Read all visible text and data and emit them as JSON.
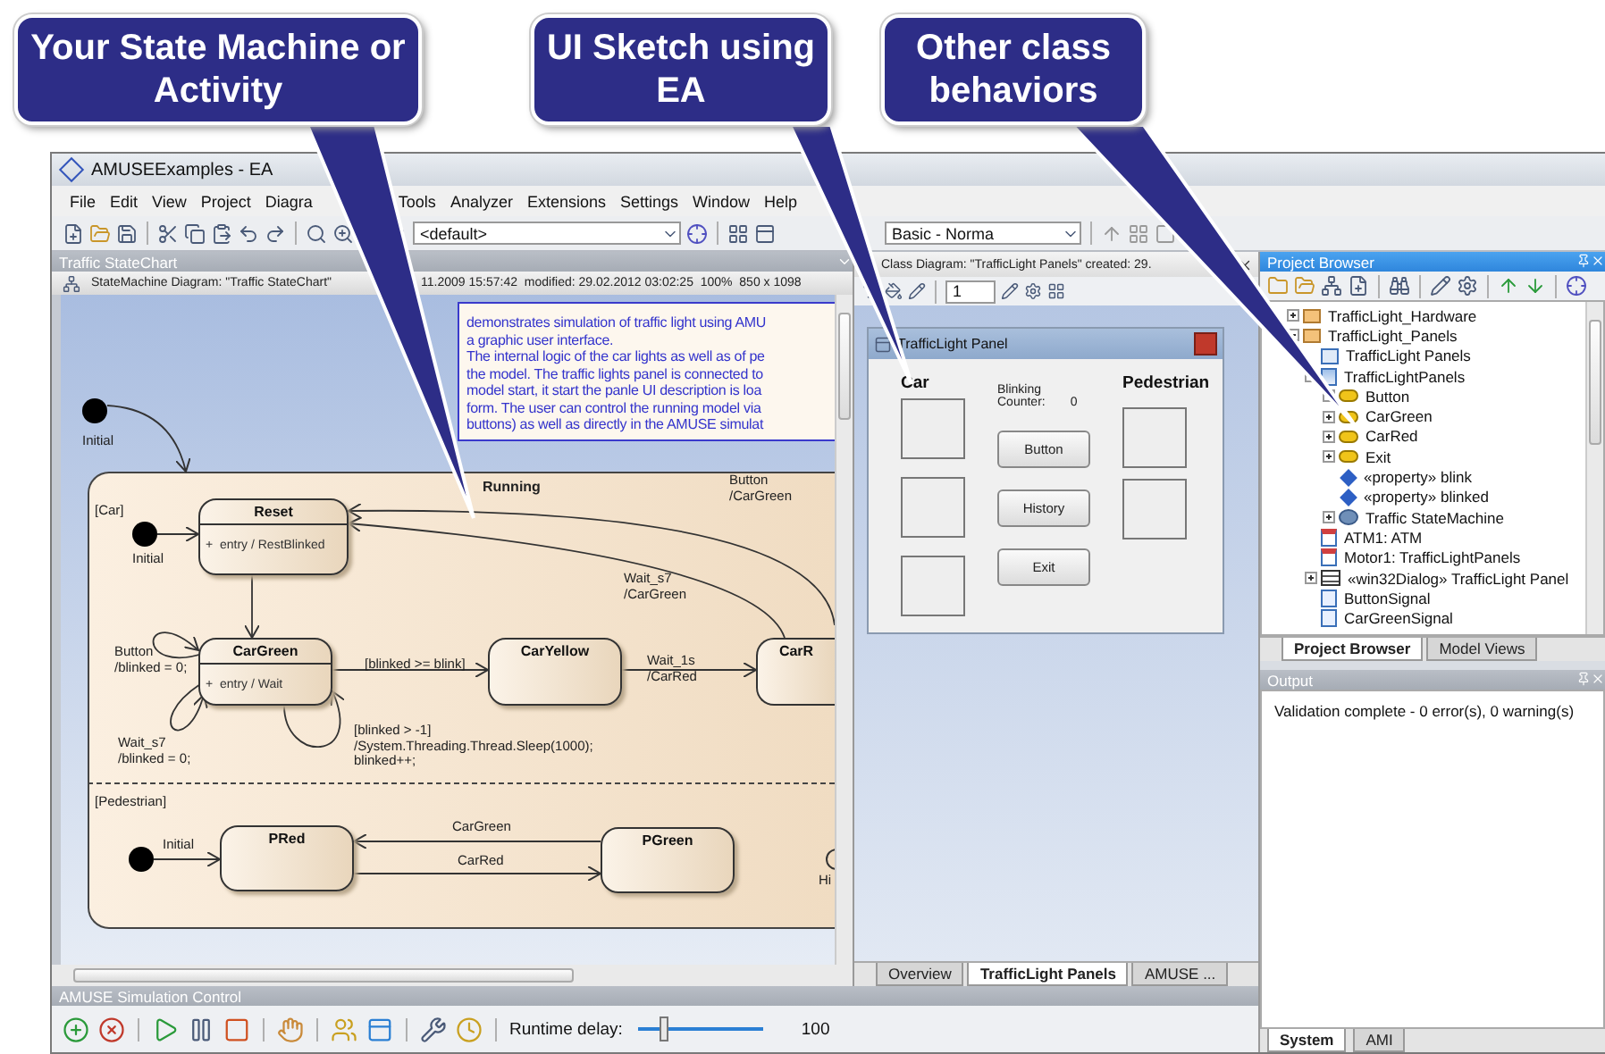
{
  "callouts": [
    {
      "text": "Your State Machine or Activity"
    },
    {
      "text": "UI Sketch using EA"
    },
    {
      "text": "Other class behaviors"
    }
  ],
  "window": {
    "title": "AMUSEExamples - EA"
  },
  "menu": [
    "File",
    "Edit",
    "View",
    "Project",
    "Diagra",
    "Tools",
    "Analyzer",
    "Extensions",
    "Settings",
    "Window",
    "Help"
  ],
  "toolbar": {
    "perspective": "<default>",
    "workspace": "Basic - Norma"
  },
  "state_chart": {
    "tab_title": "Traffic StateChart",
    "diagram_info": "StateMachine Diagram: \"Traffic StateChart\"",
    "diagram_meta": "11.2009 15:57:42  modified: 29.02.2012 03:02:25  100%  850 x 1098",
    "note": [
      "demonstrates simulation of traffic light using AMU",
      "a graphic user interface.",
      "The internal logic of the car lights as well as of pe",
      "the model. The traffic lights panel is connected to",
      "model start, it start the panle UI description is loa",
      "form. The user can control the running model via",
      "buttons) as well as directly in the AMUSE simulat"
    ],
    "initials": [
      "Initial",
      "Initial",
      "Initial"
    ],
    "composite": "Running",
    "regions": [
      "[Car]",
      "[Pedestrian]"
    ],
    "states": [
      {
        "name": "Reset",
        "activity": "+  entry / RestBlinked"
      },
      {
        "name": "CarGreen",
        "activity": "+  entry / Wait"
      },
      {
        "name": "CarYellow"
      },
      {
        "name": "CarR"
      },
      {
        "name": "PRed"
      },
      {
        "name": "PGreen"
      }
    ],
    "transition_labels": [
      "Button\n/CarGreen",
      "Wait_s7\n/CarGreen",
      "Button\n/blinked = 0;",
      "Wait_s7\n/blinked = 0;",
      "[blinked >= blink]",
      "Wait_1s\n/CarRed",
      "[blinked > -1]\n/System.Threading.Thread.Sleep(1000);\nblinked++;",
      "CarGreen",
      "CarRed"
    ],
    "history_label": "Hi"
  },
  "class_diagram": {
    "header": "Class Diagram: \"TrafficLight Panels\" created: 29.",
    "zoom": "1",
    "form": {
      "title": "TrafficLight Panel",
      "car_label": "Car",
      "counter_label": "Blinking\nCounter:",
      "counter_value": "0",
      "buttons": [
        "Button",
        "History",
        "Exit"
      ],
      "pedestrian_label": "Pedestrian"
    },
    "tabs": [
      {
        "label": "Overview",
        "selected": false
      },
      {
        "label": "TrafficLight Panels",
        "selected": true
      },
      {
        "label": "AMUSE ...",
        "selected": false
      }
    ]
  },
  "project_browser": {
    "title": "Project Browser",
    "tree": [
      {
        "label": "TrafficLight_Hardware",
        "kind": "folder",
        "expanded": false
      },
      {
        "label": "TrafficLight_Panels",
        "kind": "folder",
        "expanded": true,
        "children": [
          {
            "label": "TrafficLight Panels",
            "kind": "diagram"
          },
          {
            "label": "TrafficLightPanels",
            "kind": "class",
            "expanded": true,
            "children": [
              {
                "label": "Button",
                "kind": "signal",
                "expanded": false
              },
              {
                "label": "CarGreen",
                "kind": "signal",
                "expanded": false
              },
              {
                "label": "CarRed",
                "kind": "signal",
                "expanded": false
              },
              {
                "label": "Exit",
                "kind": "signal",
                "expanded": false
              },
              {
                "label": "«property» blink",
                "kind": "property"
              },
              {
                "label": "«property» blinked",
                "kind": "property"
              },
              {
                "label": "Traffic StateMachine",
                "kind": "statemachine",
                "expanded": false
              }
            ]
          },
          {
            "label": "ATM1: ATM",
            "kind": "object"
          },
          {
            "label": "Motor1: TrafficLightPanels",
            "kind": "object"
          },
          {
            "label": "«win32Dialog» TrafficLight Panel",
            "kind": "dialog",
            "expanded": false
          },
          {
            "label": "ButtonSignal",
            "kind": "signalclass"
          },
          {
            "label": "CarGreenSignal",
            "kind": "signalclass"
          }
        ]
      }
    ],
    "tabs": [
      {
        "label": "Project Browser",
        "selected": true
      },
      {
        "label": "Model Views",
        "selected": false
      }
    ]
  },
  "output": {
    "title": "Output",
    "lines": [
      "Validation complete - 0 error(s), 0 warning(s)"
    ],
    "tabs": [
      {
        "label": "System",
        "selected": true
      },
      {
        "label": "AMI",
        "selected": false
      }
    ]
  },
  "simulation": {
    "title": "AMUSE Simulation Control",
    "delay_label": "Runtime delay:",
    "delay": {
      "level": 0.2
    },
    "delay_value": "100"
  }
}
